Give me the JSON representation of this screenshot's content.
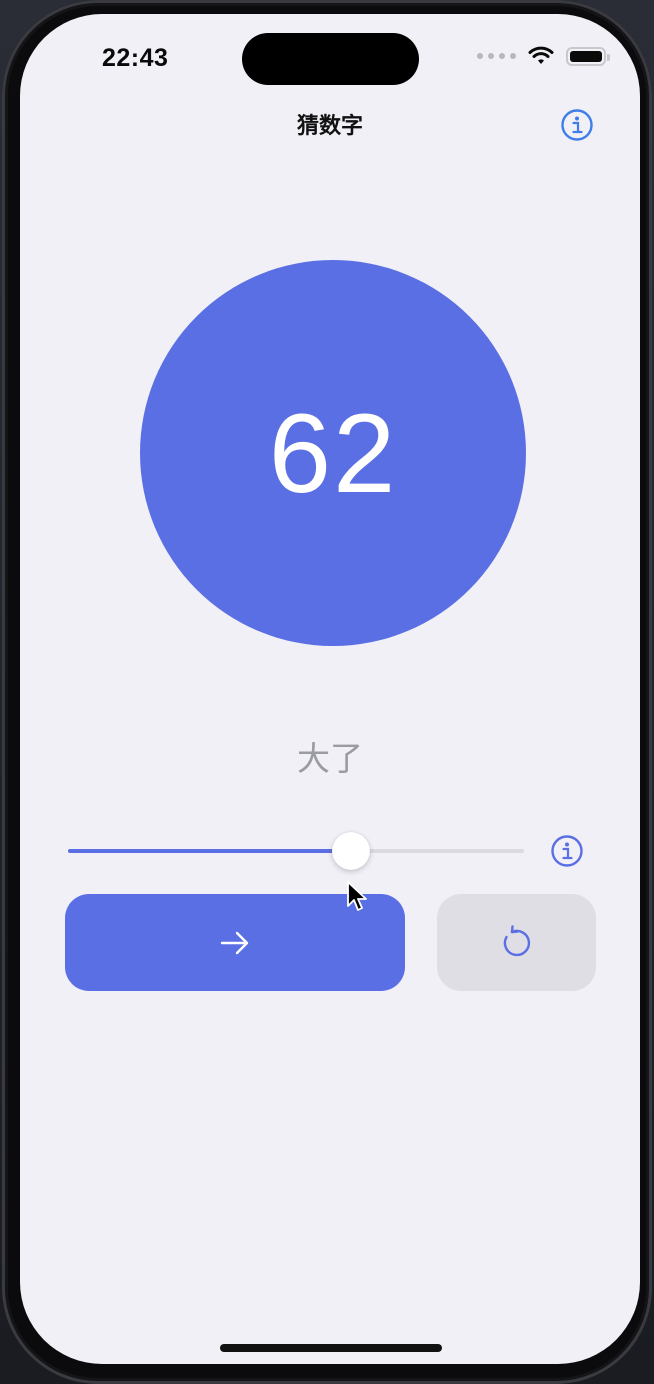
{
  "status_bar": {
    "time": "22:43",
    "icons": [
      "wifi-icon",
      "battery-icon"
    ]
  },
  "nav": {
    "title": "猜数字",
    "info_icon": "info-circle-icon"
  },
  "game": {
    "current_number": "62",
    "hint": "大了",
    "slider_value_fraction": 0.62
  },
  "controls": {
    "slider_info_icon": "info-circle-icon",
    "submit_icon": "arrow-right-icon",
    "reset_icon": "rotate-ccw-icon"
  },
  "colors": {
    "accent": "#5b6fe4",
    "background": "#f1f0f7",
    "secondary_button": "#dfdee5",
    "hint_text": "#9b9ba2"
  }
}
